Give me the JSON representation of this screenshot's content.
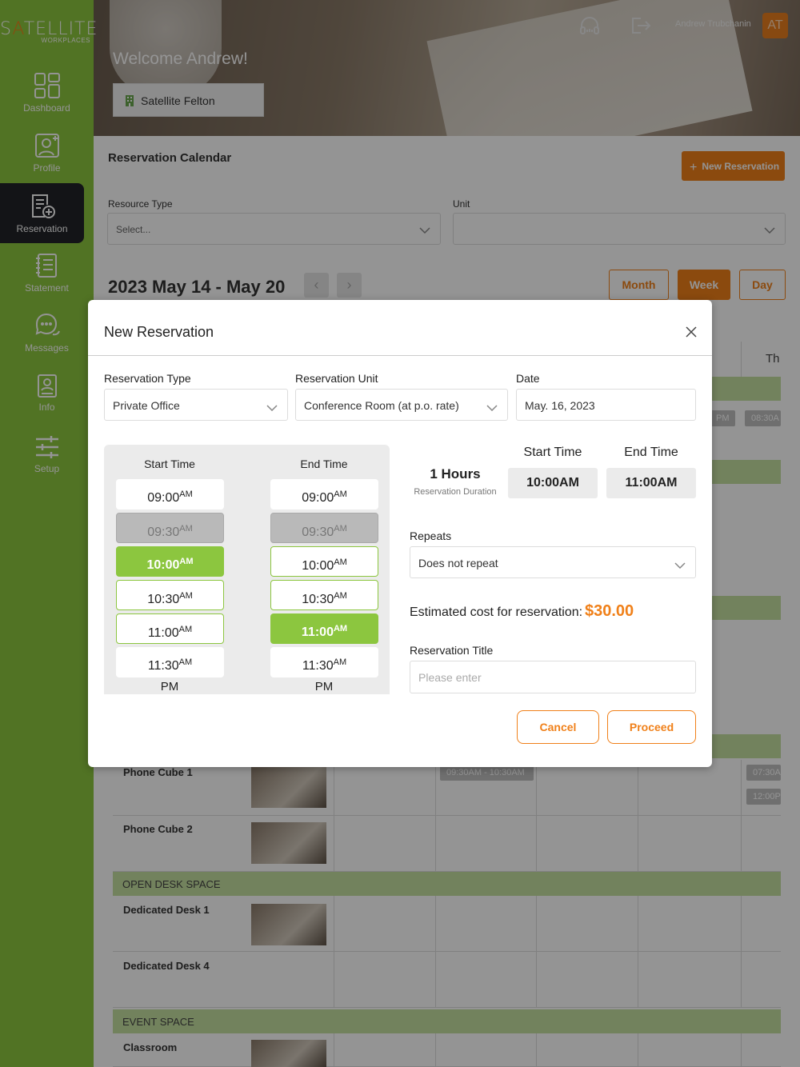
{
  "brand": {
    "name_pre": "S",
    "name_accent": "A",
    "name_post": "TELLITE",
    "tagline": "WORKPLACES",
    "accent_color": "#f08019",
    "green": "#8cc63f"
  },
  "sidebar": {
    "items": [
      {
        "label": "Dashboard",
        "icon": "dashboard-icon",
        "active": false
      },
      {
        "label": "Profile",
        "icon": "profile-icon",
        "active": false
      },
      {
        "label": "Reservation",
        "icon": "reservation-icon",
        "active": true
      },
      {
        "label": "Statement",
        "icon": "statement-icon",
        "active": false
      },
      {
        "label": "Messages",
        "icon": "messages-icon",
        "active": false
      },
      {
        "label": "Info",
        "icon": "info-icon",
        "active": false
      },
      {
        "label": "Setup",
        "icon": "setup-icon",
        "active": false
      }
    ]
  },
  "header": {
    "welcome": "Welcome Andrew!",
    "location": "Satellite Felton",
    "user_name": "Andrew Trubchanin",
    "avatar_initials": "AT"
  },
  "calendar": {
    "title": "Reservation Calendar",
    "new_reservation": "New Reservation",
    "resource_type_label": "Resource Type",
    "resource_type_placeholder": "Select...",
    "unit_label": "Unit",
    "range": "2023 May 14 - May 20",
    "views": {
      "month": "Month",
      "week": "Week",
      "day": "Day"
    },
    "day_header_partial": "Th",
    "chips": [
      "PM",
      "08:30A",
      "09:30AM - 10:30AM",
      "07:30A",
      "12:00P"
    ],
    "groups": {
      "open_desk": "OPEN DESK SPACE",
      "event": "EVENT SPACE"
    },
    "resources": [
      "Phone Cube 1",
      "Phone Cube 2",
      "Dedicated Desk 1",
      "Dedicated Desk 4",
      "Classroom"
    ]
  },
  "modal": {
    "title": "New Reservation",
    "reservation_type_label": "Reservation Type",
    "reservation_type_value": "Private Office",
    "reservation_unit_label": "Reservation Unit",
    "reservation_unit_value": "Conference Room (at p.o. rate)",
    "date_label": "Date",
    "date_value": "May. 16, 2023",
    "start_time_head": "Start Time",
    "end_time_head": "End Time",
    "start_slots": [
      {
        "time": "09:00",
        "ampm": "AM"
      },
      {
        "time": "09:30",
        "ampm": "AM"
      },
      {
        "time": "10:00",
        "ampm": "AM"
      },
      {
        "time": "10:30",
        "ampm": "AM"
      },
      {
        "time": "11:00",
        "ampm": "AM"
      },
      {
        "time": "11:30",
        "ampm": "AM"
      }
    ],
    "end_slots": [
      {
        "time": "09:00",
        "ampm": "AM"
      },
      {
        "time": "09:30",
        "ampm": "AM"
      },
      {
        "time": "10:00",
        "ampm": "AM"
      },
      {
        "time": "10:30",
        "ampm": "AM"
      },
      {
        "time": "11:00",
        "ampm": "AM"
      },
      {
        "time": "11:30",
        "ampm": "AM"
      }
    ],
    "pm_label": "PM",
    "duration_value": "1 Hours",
    "duration_label": "Reservation Duration",
    "summary_start_head": "Start Time",
    "summary_end_head": "End Time",
    "summary_start": "10:00AM",
    "summary_end": "11:00AM",
    "repeats_label": "Repeats",
    "repeats_value": "Does not repeat",
    "cost_label": "Estimated cost for reservation:",
    "cost_value": "$30.00",
    "title_label": "Reservation Title",
    "title_placeholder": "Please enter",
    "cancel": "Cancel",
    "proceed": "Proceed"
  }
}
